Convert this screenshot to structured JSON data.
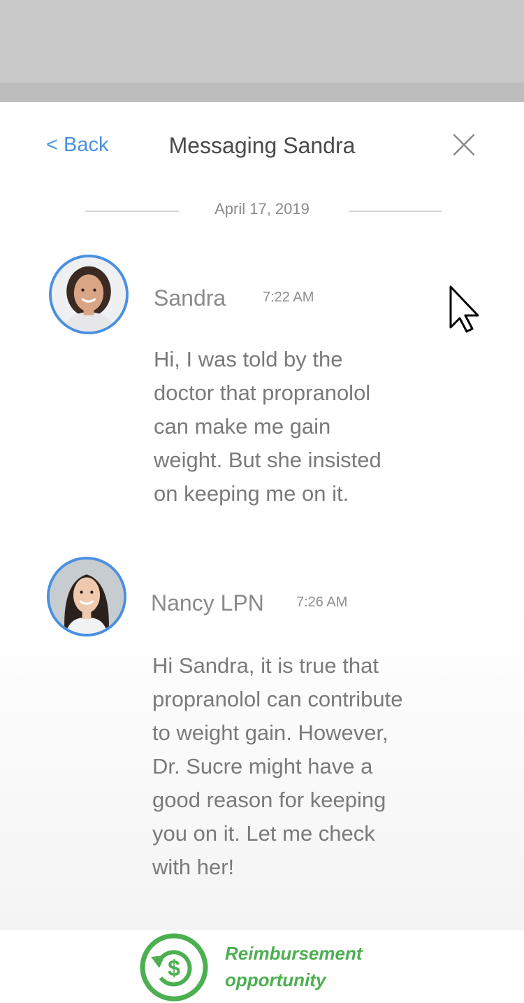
{
  "header": {
    "back_label": "< Back",
    "title": "Messaging Sandra",
    "close_icon": "close-icon"
  },
  "conversation": {
    "date": "April 17, 2019",
    "messages": [
      {
        "sender": "Sandra",
        "time": "7:22 AM",
        "text": "Hi, I was told by the\ndoctor that propranolol\ncan make me gain\nweight. But she insisted\non keeping me on it."
      },
      {
        "sender": "Nancy LPN",
        "time": "7:26 AM",
        "text": "Hi Sandra, it is true that\npropranolol can contribute\nto weight gain. However,\nDr. Sucre might have a\ngood reason for keeping\nyou on it. Let me check\nwith her!"
      }
    ]
  },
  "footer": {
    "label": "Reimbursement\nopportunity",
    "icon": "dollar-refresh-icon"
  },
  "colors": {
    "accent": "#4a90e2",
    "success": "#4caf50",
    "top_overlay": "#c9c9c9"
  }
}
